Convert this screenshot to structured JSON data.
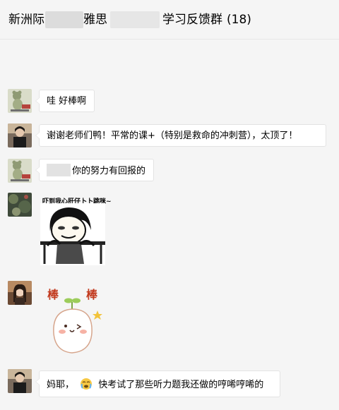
{
  "header": {
    "title_part1": "新洲际",
    "title_part2": "雅思",
    "title_part3": "学习反馈群",
    "member_count": "(18)"
  },
  "messages": [
    {
      "text": "哇 好棒啊",
      "avatar_icon": "bear-avatar-icon"
    },
    {
      "text": "谢谢老师们鸭！平常的课+（特别是救命的冲刺营），太顶了！",
      "avatar_icon": "person-avatar-icon"
    },
    {
      "text": "你的努力有回报的",
      "avatar_icon": "bear-avatar-icon"
    },
    {
      "sticker_caption": "吓到我心肝仔卜卜跳咪~",
      "sticker_icon": "panda-meme-sticker-icon",
      "avatar_icon": "plant-avatar-icon"
    },
    {
      "sticker_chars": [
        "棒",
        "棒"
      ],
      "sticker_icon": "sprout-bun-sticker-icon",
      "avatar_icon": "woman-avatar-icon"
    },
    {
      "text_before": "妈耶，",
      "text_after": "快考试了那些听力题我还做的哼唏哼唏的",
      "emoji_icon": "crying-face-icon",
      "avatar_icon": "person-avatar-icon"
    }
  ],
  "colors": {
    "background": "#f5f5f5",
    "bubble": "#ffffff",
    "sticker_text": "#c23a1e"
  }
}
